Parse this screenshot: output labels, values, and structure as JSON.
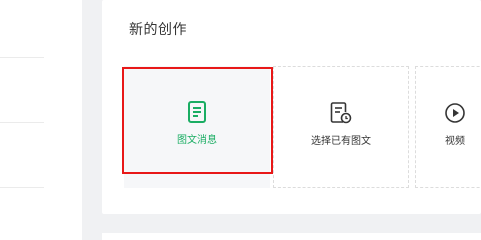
{
  "creation": {
    "title": "新的创作",
    "tiles": [
      {
        "label": "图文消息",
        "icon": "document-icon"
      },
      {
        "label": "选择已有图文",
        "icon": "document-clock-icon"
      },
      {
        "label": "视频",
        "icon": "video-play-icon"
      }
    ]
  },
  "colors": {
    "accent_green": "#1aad63",
    "highlight_red": "#e81818",
    "page_background": "#f0f1f3"
  }
}
